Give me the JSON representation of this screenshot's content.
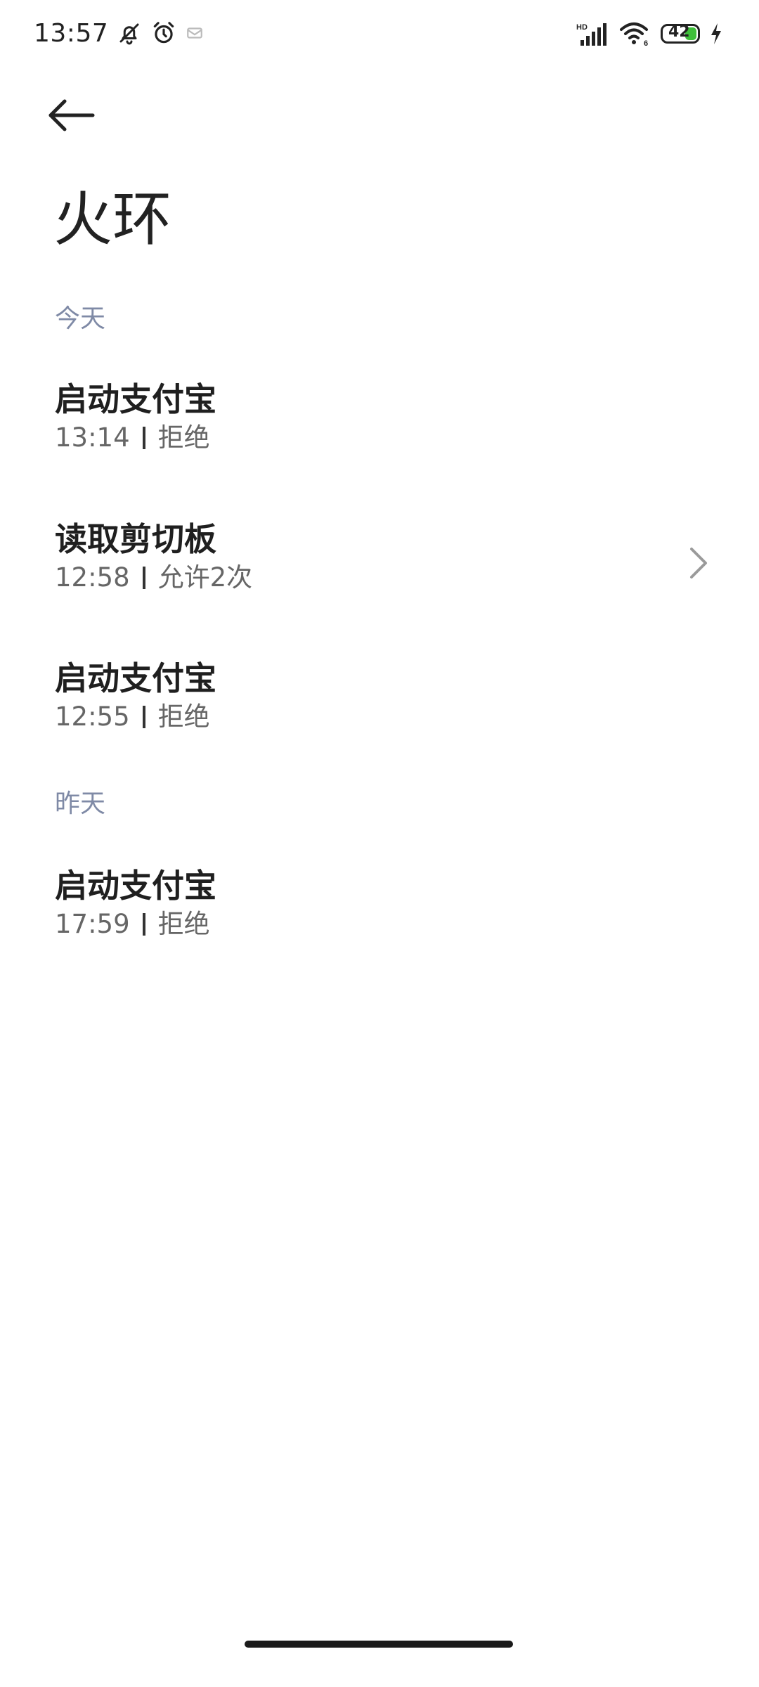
{
  "status_bar": {
    "time": "13:57",
    "battery": "42",
    "icons": [
      "bell-off-icon",
      "alarm-icon",
      "notification-icon",
      "hd-signal-icon",
      "wifi-icon",
      "battery-icon",
      "charging-icon"
    ]
  },
  "header": {
    "back_icon": "arrow-left-icon",
    "title": "火环"
  },
  "sections": [
    {
      "label": "今天",
      "items": [
        {
          "title": "启动支付宝",
          "time": "13:14",
          "result": "拒绝"
        },
        {
          "title": "读取剪切板",
          "time": "12:58",
          "result": "允许2次"
        },
        {
          "title": "启动支付宝",
          "time": "12:55",
          "result": "拒绝"
        }
      ]
    },
    {
      "label": "昨天",
      "items": [
        {
          "title": "启动支付宝",
          "time": "17:59",
          "result": "拒绝"
        }
      ]
    }
  ],
  "colors": {
    "section_header": "#7f8aa6",
    "battery_fill": "#3fbf3a"
  }
}
